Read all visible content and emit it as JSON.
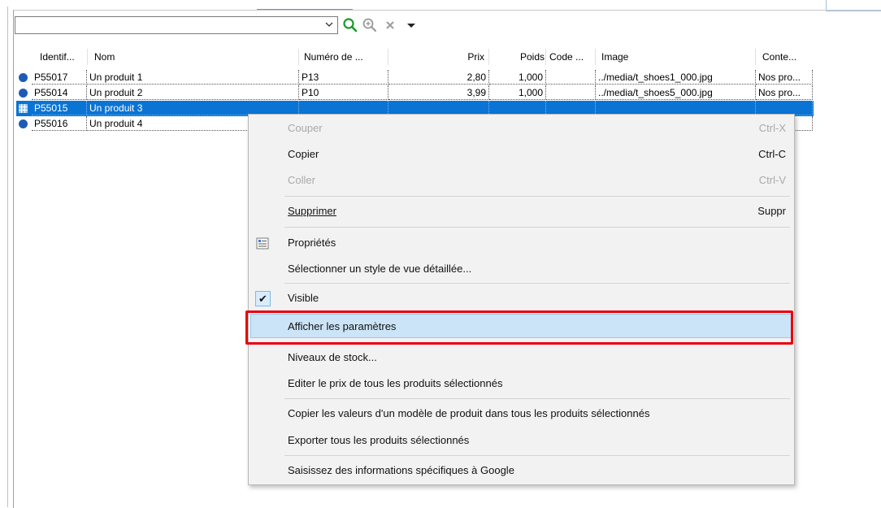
{
  "toolbar": {
    "search_value": "",
    "icons": [
      "chevron-down-icon",
      "search-icon",
      "zoom-in-icon",
      "clear-icon",
      "dropdown-icon"
    ],
    "accent_color": "#1a9a2a"
  },
  "grid": {
    "columns": [
      "Identif...",
      "Nom",
      "Numéro de ...",
      "Prix",
      "Poids",
      "Code ...",
      "Image",
      "Conte..."
    ],
    "rows": [
      {
        "id": "P55017",
        "name": "Un produit 1",
        "number": "P13",
        "price": "2,80",
        "weight": "1,000",
        "code": "",
        "image": "../media/t_shoes1_000.jpg",
        "content": "Nos pro...",
        "selected": false
      },
      {
        "id": "P55014",
        "name": "Un produit 2",
        "number": "P10",
        "price": "3,99",
        "weight": "1,000",
        "code": "",
        "image": "../media/t_shoes5_000.jpg",
        "content": "Nos pro...",
        "selected": false
      },
      {
        "id": "P55015",
        "name": "Un produit 3",
        "number": "",
        "price": "",
        "weight": "",
        "code": "",
        "image": "",
        "content": "",
        "selected": true
      },
      {
        "id": "P55016",
        "name": "Un produit 4",
        "number": "",
        "price": "",
        "weight": "",
        "code": "",
        "image": "",
        "content": "",
        "selected": false
      }
    ],
    "selection_color": "#0a74d5"
  },
  "menu": {
    "items": [
      {
        "label": "Couper",
        "accel": "Ctrl-X",
        "disabled": true
      },
      {
        "label": "Copier",
        "accel": "Ctrl-C",
        "disabled": false
      },
      {
        "label": "Coller",
        "accel": "Ctrl-V",
        "disabled": true
      },
      {
        "label": "Supprimer",
        "accel": "Suppr",
        "disabled": false
      },
      {
        "label": "Propriétés",
        "accel": "",
        "disabled": false,
        "icon": "properties-icon"
      },
      {
        "label": "Sélectionner un style de vue détaillée...",
        "accel": "",
        "disabled": false
      },
      {
        "label": "Visible",
        "accel": "",
        "disabled": false,
        "checked": true
      },
      {
        "label": "Afficher les paramètres",
        "accel": "",
        "disabled": false,
        "hovered": true
      },
      {
        "label": "Niveaux de stock...",
        "accel": "",
        "disabled": false
      },
      {
        "label": "Editer le prix de tous les produits sélectionnés",
        "accel": "",
        "disabled": false
      },
      {
        "label": "Copier les valeurs d'un modèle de produit dans tous les produits sélectionnés",
        "accel": "",
        "disabled": false
      },
      {
        "label": "Exporter tous les produits sélectionnés",
        "accel": "",
        "disabled": false
      },
      {
        "label": "Saisissez des informations spécifiques à Google",
        "accel": "",
        "disabled": false
      }
    ],
    "highlight_color": "#e8000b"
  }
}
